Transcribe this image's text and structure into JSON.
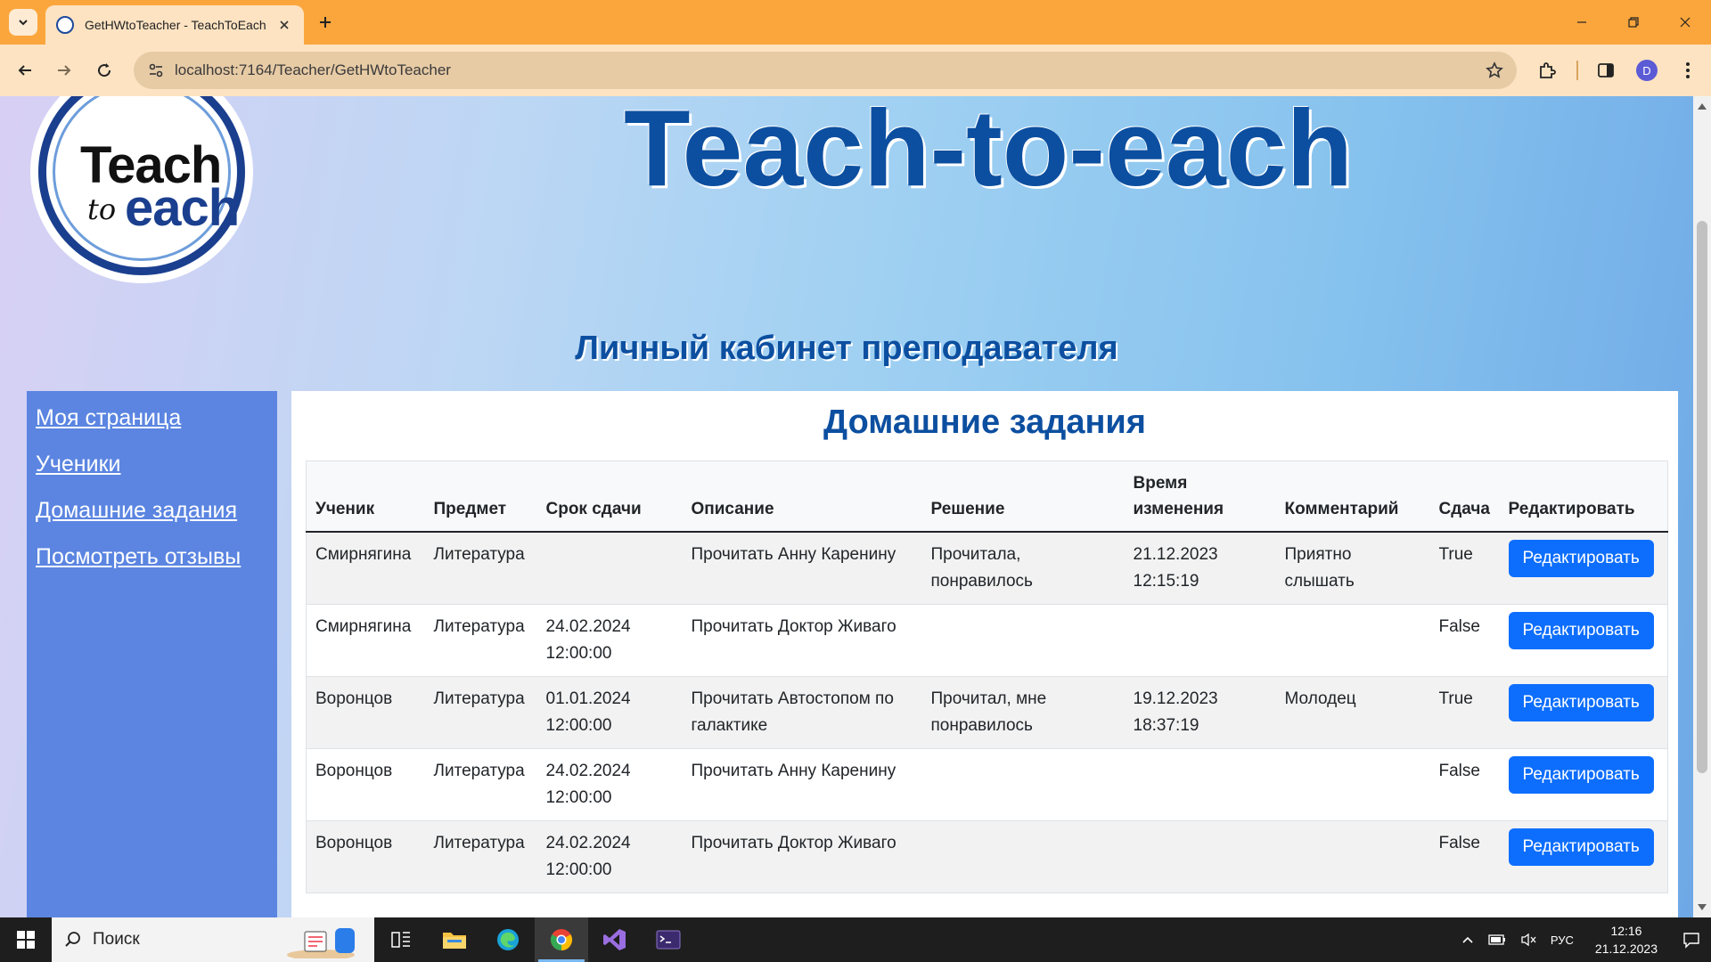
{
  "browser": {
    "tab_title": "GetHWtoTeacher - TeachToEach",
    "url": "localhost:7164/Teacher/GetHWtoTeacher",
    "profile_initial": "D"
  },
  "header": {
    "logo_line1": "Teach",
    "logo_line2": "to",
    "logo_line3": "each",
    "site_title": "Teach-to-each",
    "cabinet_title": "Личный кабинет преподавателя"
  },
  "sidebar": {
    "items": [
      {
        "label": "Моя страница"
      },
      {
        "label": "Ученики"
      },
      {
        "label": "Домашние задания"
      },
      {
        "label": "Посмотреть отзывы"
      }
    ]
  },
  "main": {
    "title": "Домашние задания",
    "columns": [
      "Ученик",
      "Предмет",
      "Срок сдачи",
      "Описание",
      "Решение",
      "Время изменения",
      "Комментарий",
      "Сдача",
      "Редактировать"
    ],
    "rows": [
      {
        "student": "Смирнягина",
        "subject": "Литература",
        "deadline": "",
        "description": "Прочитать Анну Каренину",
        "solution": "Прочитала, понравилось",
        "changed": "21.12.2023 12:15:19",
        "comment": "Приятно слышать",
        "submitted": "True",
        "edit": "Редактировать"
      },
      {
        "student": "Смирнягина",
        "subject": "Литература",
        "deadline": "24.02.2024 12:00:00",
        "description": "Прочитать Доктор Живаго",
        "solution": "",
        "changed": "",
        "comment": "",
        "submitted": "False",
        "edit": "Редактировать"
      },
      {
        "student": "Воронцов",
        "subject": "Литература",
        "deadline": "01.01.2024 12:00:00",
        "description": "Прочитать Автостопом по галактике",
        "solution": "Прочитал, мне понравилось",
        "changed": "19.12.2023 18:37:19",
        "comment": "Молодец",
        "submitted": "True",
        "edit": "Редактировать"
      },
      {
        "student": "Воронцов",
        "subject": "Литература",
        "deadline": "24.02.2024 12:00:00",
        "description": "Прочитать Анну Каренину",
        "solution": "",
        "changed": "",
        "comment": "",
        "submitted": "False",
        "edit": "Редактировать"
      },
      {
        "student": "Воронцов",
        "subject": "Литература",
        "deadline": "24.02.2024 12:00:00",
        "description": "Прочитать Доктор Живаго",
        "solution": "",
        "changed": "",
        "comment": "",
        "submitted": "False",
        "edit": "Редактировать"
      }
    ]
  },
  "taskbar": {
    "search_placeholder": "Поиск",
    "language": "РУС",
    "time": "12:16",
    "date": "21.12.2023"
  },
  "colors": {
    "brand_blue": "#0c4fa0",
    "sidebar_bg": "#5b85e1",
    "button_blue": "#0d6efd",
    "tabstrip_orange": "#fba63c"
  }
}
